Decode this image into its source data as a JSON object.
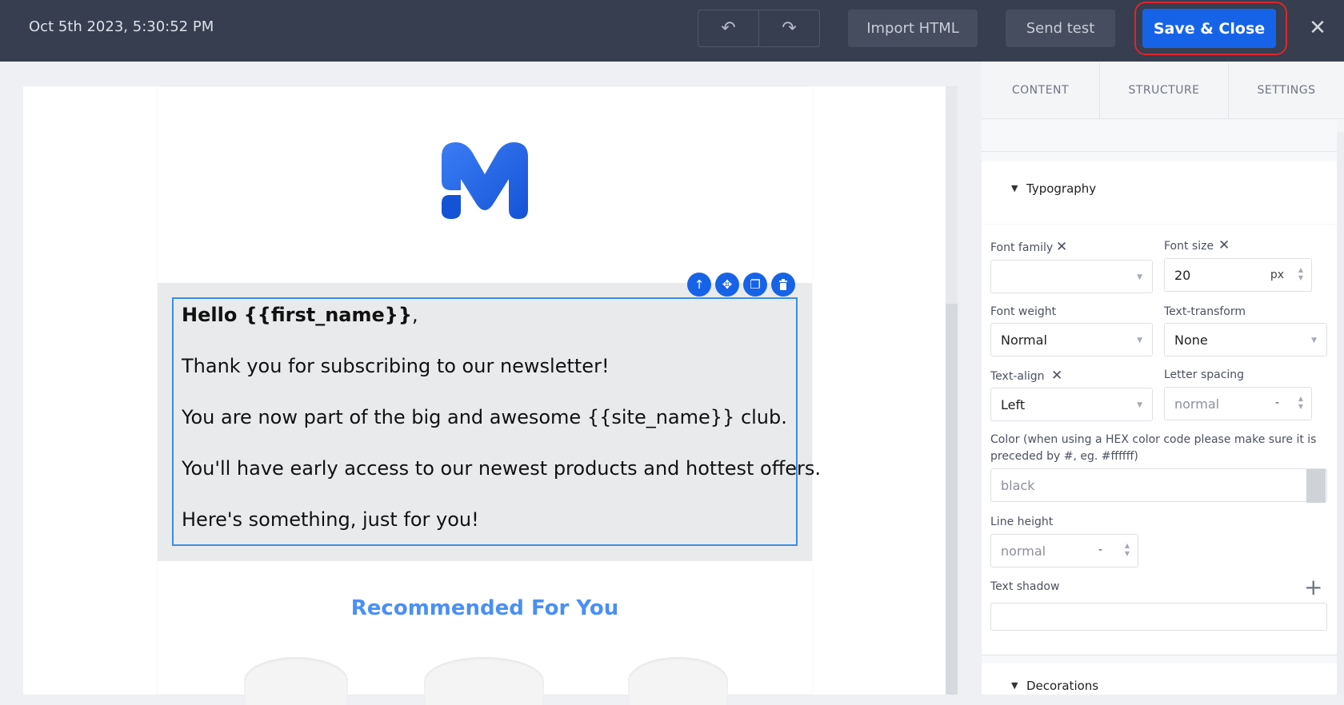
{
  "topbar": {
    "timestamp": "Oct 5th 2023, 5:30:52 PM",
    "undo_icon": "↶",
    "redo_icon": "↷",
    "import_label": "Import HTML",
    "send_test_label": "Send test",
    "save_close_label": "Save & Close",
    "close_icon": "✕",
    "accent_color": "#1763e8"
  },
  "email": {
    "greeting_bold": "Hello {{first_name}}",
    "greeting_punct": ",",
    "lines": [
      "Thank you for subscribing to our newsletter!",
      "You are now part of the big and awesome {{site_name}} club.",
      "You'll have early access to our newest products and hottest offers.",
      "Here's something, just for you!"
    ],
    "section_title": "Recommended For You",
    "block_tools": [
      "arrow-up-icon",
      "move-icon",
      "copy-icon",
      "trash-icon"
    ]
  },
  "panel": {
    "tabs": [
      "CONTENT",
      "STRUCTURE",
      "SETTINGS"
    ],
    "typography_label": "Typography",
    "decorations_label": "Decorations",
    "font_family_label": "Font family",
    "font_family_value": "",
    "font_size_label": "Font size",
    "font_size_value": "20",
    "font_size_unit": "px",
    "font_weight_label": "Font weight",
    "font_weight_value": "Normal",
    "text_transform_label": "Text-transform",
    "text_transform_value": "None",
    "text_align_label": "Text-align",
    "text_align_value": "Left",
    "letter_spacing_label": "Letter spacing",
    "letter_spacing_value": "normal",
    "letter_spacing_unit": "-",
    "color_label_line1": "Color (when using a HEX color code please make sure it is",
    "color_label_line2": "preceded by #, eg. #ffffff)",
    "color_value": "black",
    "line_height_label": "Line height",
    "line_height_value": "normal",
    "line_height_unit": "-",
    "text_shadow_label": "Text shadow",
    "add_icon": "+",
    "clear_icon": "✕"
  }
}
